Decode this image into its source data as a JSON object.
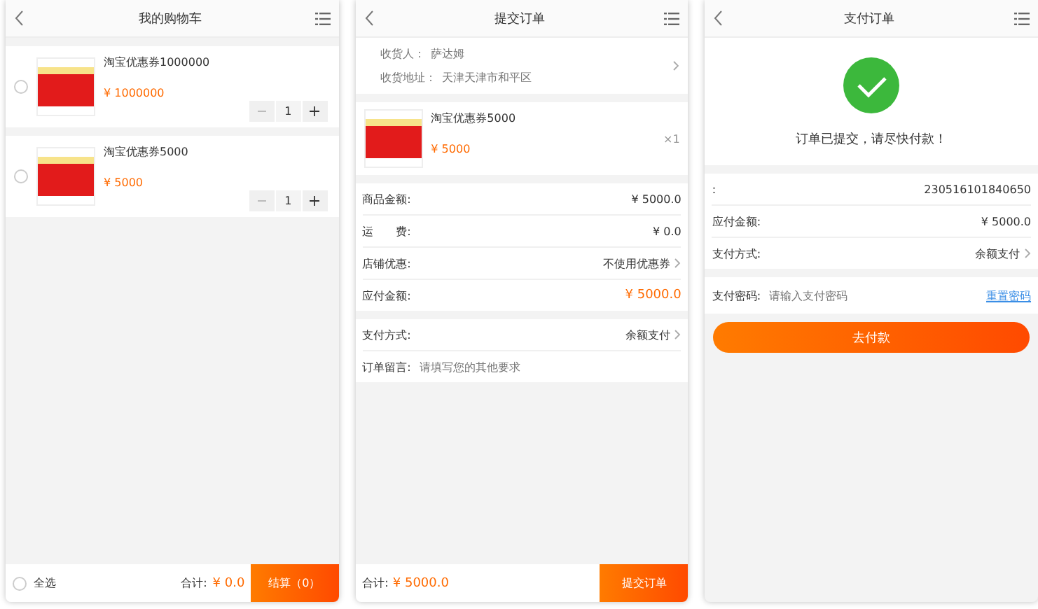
{
  "screens": [
    {
      "kind": "cart",
      "title": "我的购物车",
      "items": [
        {
          "name": "淘宝优惠券1000000",
          "price": "¥ 1000000",
          "quantity": "1",
          "selected": false
        },
        {
          "name": "淘宝优惠券5000",
          "price": "¥ 5000",
          "quantity": "1",
          "selected": false
        }
      ],
      "footer": {
        "select_all_label": "全选",
        "select_all_checked": false,
        "total_label": "合计:",
        "total": "¥ 0.0",
        "button": "结算（0）"
      }
    },
    {
      "kind": "submit",
      "title": "提交订单",
      "address": {
        "recipient_label": "收货人：",
        "recipient": "萨达姆",
        "address_label": "收货地址：",
        "address": "天津天津市和平区"
      },
      "product": {
        "name": "淘宝优惠券5000",
        "price": "¥ 5000",
        "quantity": "×1"
      },
      "sections": [
        [
          {
            "kind": "plain",
            "label": "商品金额:",
            "value": "¥ 5000.0"
          },
          {
            "kind": "plain",
            "label": "运　　费:",
            "value": "¥ 0.0"
          },
          {
            "kind": "link",
            "label": "店铺优惠:",
            "value": "不使用优惠券"
          },
          {
            "kind": "highlight",
            "label": "应付金额:",
            "value": "¥ 5000.0"
          }
        ],
        [
          {
            "kind": "link",
            "label": "支付方式:",
            "value": "余额支付"
          },
          {
            "kind": "input",
            "label": "订单留言:",
            "placeholder": "请填写您的其他要求"
          }
        ]
      ],
      "footer": {
        "total_label": "合计:",
        "total": "¥ 5000.0",
        "button": "提交订单"
      }
    },
    {
      "kind": "pay",
      "title": "支付订单",
      "message": "订单已提交，请尽快付款！",
      "sections": [
        [
          {
            "kind": "plain",
            "label": ":",
            "value": "230516101840650"
          },
          {
            "kind": "plain",
            "label": "应付金额:",
            "value": "¥ 5000.0"
          },
          {
            "kind": "link",
            "label": "支付方式:",
            "value": "余额支付"
          }
        ],
        [
          {
            "kind": "password",
            "label": "支付密码:",
            "placeholder": "请输入支付密码",
            "link": "重置密码"
          }
        ]
      ],
      "button": "去付款"
    }
  ]
}
